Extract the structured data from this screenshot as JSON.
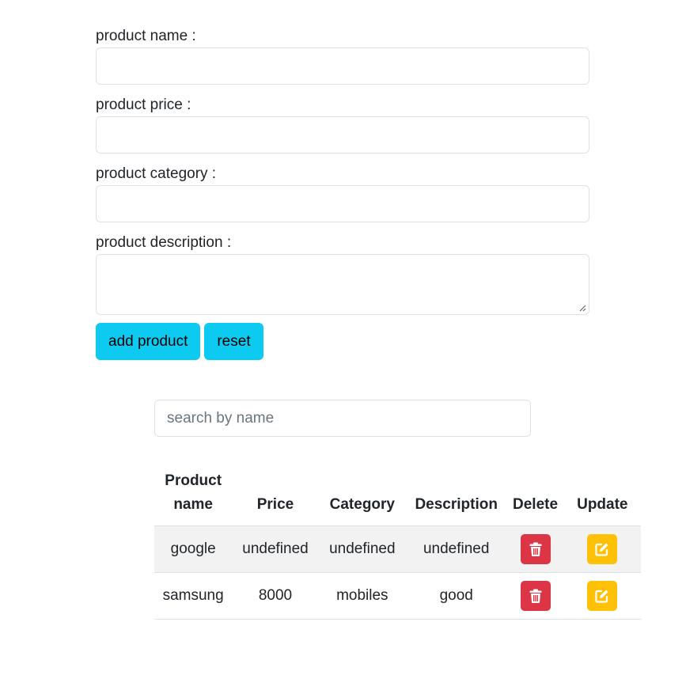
{
  "form": {
    "name_label": "product name :",
    "price_label": "product price :",
    "category_label": "product category :",
    "description_label": "product description :",
    "name_value": "",
    "price_value": "",
    "category_value": "",
    "description_value": "",
    "add_label": "add product",
    "reset_label": "reset"
  },
  "search": {
    "placeholder": "search by name",
    "value": ""
  },
  "table": {
    "headers": {
      "name": "Product name",
      "price": "Price",
      "category": "Category",
      "description": "Description",
      "delete": "Delete",
      "update": "Update"
    },
    "rows": [
      {
        "name": "google",
        "price": "undefined",
        "category": "undefined",
        "description": "undefined"
      },
      {
        "name": "samsung",
        "price": "8000",
        "category": "mobiles",
        "description": "good"
      }
    ]
  },
  "icons": {
    "delete": "trash-icon",
    "update": "edit-icon"
  },
  "colors": {
    "info": "#0dcaf0",
    "danger": "#dc3545",
    "warning": "#ffc107",
    "stripe": "#f2f2f2"
  }
}
